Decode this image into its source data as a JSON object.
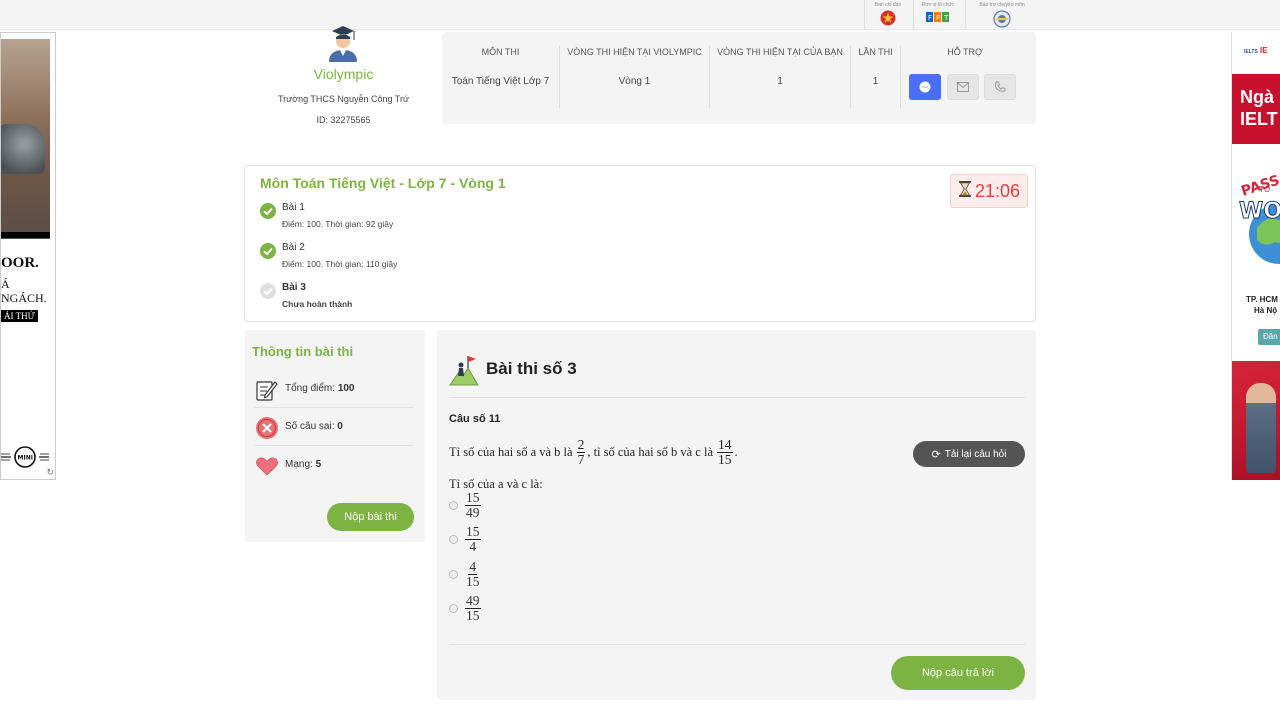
{
  "topbar": {
    "sponsors": [
      {
        "caption": "Ban chỉ đạo",
        "icon": "emblem-icon"
      },
      {
        "caption": "Đơn vị tổ chức",
        "icon": "fpt-logo-icon"
      },
      {
        "caption": "Bảo trợ chuyên môn",
        "icon": "ministry-logo-icon"
      }
    ]
  },
  "ad_left": {
    "line1": "OOR.",
    "line2": "Á",
    "line3": "NGÁCH.",
    "cta": "ÁI THỬ",
    "brand": "MINI"
  },
  "ad_right": {
    "brand_a": "IELTS",
    "brand_b": "IE",
    "headline_1": "Ngà",
    "headline_2": "IELT",
    "cities_1": "TP. HCM",
    "cities_2": "Hà Nộ",
    "button": "Đăn"
  },
  "user": {
    "logo_name": "Violympic",
    "school": "Trường THCS Nguyễn Công Trứ",
    "id_text": "ID: 32275565"
  },
  "info": {
    "headers": [
      "MÔN THI",
      "VÒNG THI HIỆN TẠI VIOLYMPIC",
      "VÒNG THI HIỆN TẠI CỦA BẠN",
      "LẦN THI",
      "HỖ TRỢ"
    ],
    "values": [
      "Toán Tiếng Việt Lớp 7",
      "Vòng 1",
      "1",
      "1"
    ]
  },
  "exam": {
    "title": "Môn Toán Tiếng Việt - Lớp 7 - Vòng 1",
    "timer": "21:06",
    "lessons": [
      {
        "name": "Bài 1",
        "meta": "Điểm: 100. Thời gian: 92 giây",
        "done": true
      },
      {
        "name": "Bài 2",
        "meta": "Điểm: 100. Thời gian: 110 giây",
        "done": true
      },
      {
        "name": "Bài 3",
        "meta": "Chưa hoàn thành",
        "done": false
      }
    ]
  },
  "exam_info": {
    "title": "Thông tin bài thi",
    "total_label": "Tổng điểm: ",
    "total_value": "100",
    "wrong_label": "Số câu sai: ",
    "wrong_value": "0",
    "lives_label": "Mạng: ",
    "lives_value": "5",
    "submit": "Nộp bài thi"
  },
  "question": {
    "title": "Bài thi số 3",
    "number": "Câu số 11",
    "text_a": "Tỉ số của hai số a và b là",
    "frac1": {
      "n": "2",
      "d": "7"
    },
    "text_b": ", tỉ số của hai số b và c là",
    "frac2": {
      "n": "14",
      "d": "15"
    },
    "text_c": ".",
    "prompt": "Tỉ số của a và c là:",
    "options": [
      {
        "n": "15",
        "d": "49"
      },
      {
        "n": "15",
        "d": "4"
      },
      {
        "n": "4",
        "d": "15"
      },
      {
        "n": "49",
        "d": "15"
      }
    ],
    "reload": "Tải lại câu hỏi",
    "submit": "Nộp câu trả lời"
  },
  "colors": {
    "accent": "#7cb342",
    "timer_red": "#e04040",
    "messenger": "#4c6ef5"
  }
}
